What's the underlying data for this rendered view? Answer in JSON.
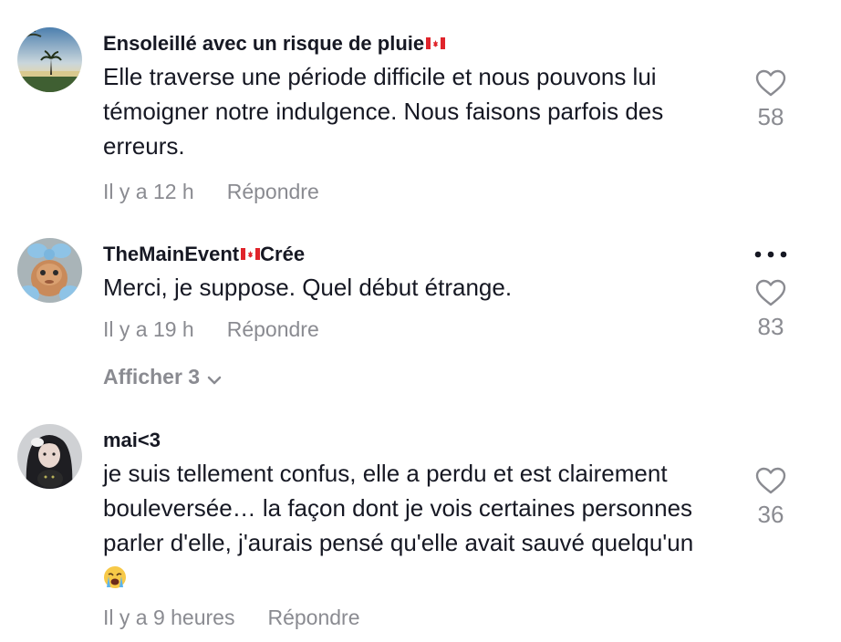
{
  "comments": [
    {
      "username": "Ensoleillé avec un risque de pluie",
      "text": "Elle traverse une période difficile et nous pouvons lui témoigner notre indulgence. Nous faisons parfois des erreurs.",
      "time": "Il y a 12 h",
      "reply_label": "Répondre",
      "likes": "58",
      "avatar_icon": "palm-beach-avatar"
    },
    {
      "username": "TheMainEvent",
      "username_suffix": "Crée",
      "text": "Merci, je suppose. Quel début étrange.",
      "time": "Il y a 19 h",
      "reply_label": "Répondre",
      "likes": "83",
      "avatar_icon": "balloon-figure-avatar"
    },
    {
      "username": "mai<3",
      "text": "je suis tellement confus, elle a perdu et est clairement bouleversée… la façon dont je vois certaines personnes parler d'elle, j'aurais pensé qu'elle avait sauvé quelqu'un",
      "time": "Il y a 9 heures",
      "reply_label": "Répondre",
      "likes": "36",
      "avatar_icon": "person-with-cat-avatar",
      "emoji_icon": "loudly-crying-face-emoji"
    }
  ],
  "view_replies_label": "Afficher 3",
  "colors": {
    "primary_text": "#161823",
    "secondary_text": "#8a8b91",
    "flag_red": "#e0242b"
  }
}
